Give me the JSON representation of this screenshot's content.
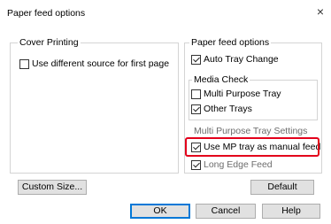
{
  "window": {
    "title": "Paper feed options",
    "close_glyph": "×"
  },
  "cover_printing": {
    "label": "Cover Printing",
    "different_source": {
      "label": "Use different source for first page",
      "checked": false
    }
  },
  "paper_feed": {
    "label": "Paper feed options",
    "auto_tray_change": {
      "label": "Auto Tray Change",
      "checked": true
    }
  },
  "media_check": {
    "label": "Media Check",
    "multi_purpose_tray": {
      "label": "Multi Purpose Tray",
      "checked": false
    },
    "other_trays": {
      "label": "Other Trays",
      "checked": true
    }
  },
  "mp_tray_settings": {
    "label": "Multi Purpose Tray Settings",
    "use_mp_manual_feed": {
      "label": "Use MP tray as manual feed",
      "checked": true
    },
    "long_edge_feed": {
      "label": "Long Edge Feed",
      "checked": true
    }
  },
  "buttons": {
    "custom_size": "Custom Size...",
    "default": "Default",
    "ok": "OK",
    "cancel": "Cancel",
    "help": "Help"
  },
  "colors": {
    "highlight": "#e3001b",
    "default_button_border": "#0078d7"
  }
}
